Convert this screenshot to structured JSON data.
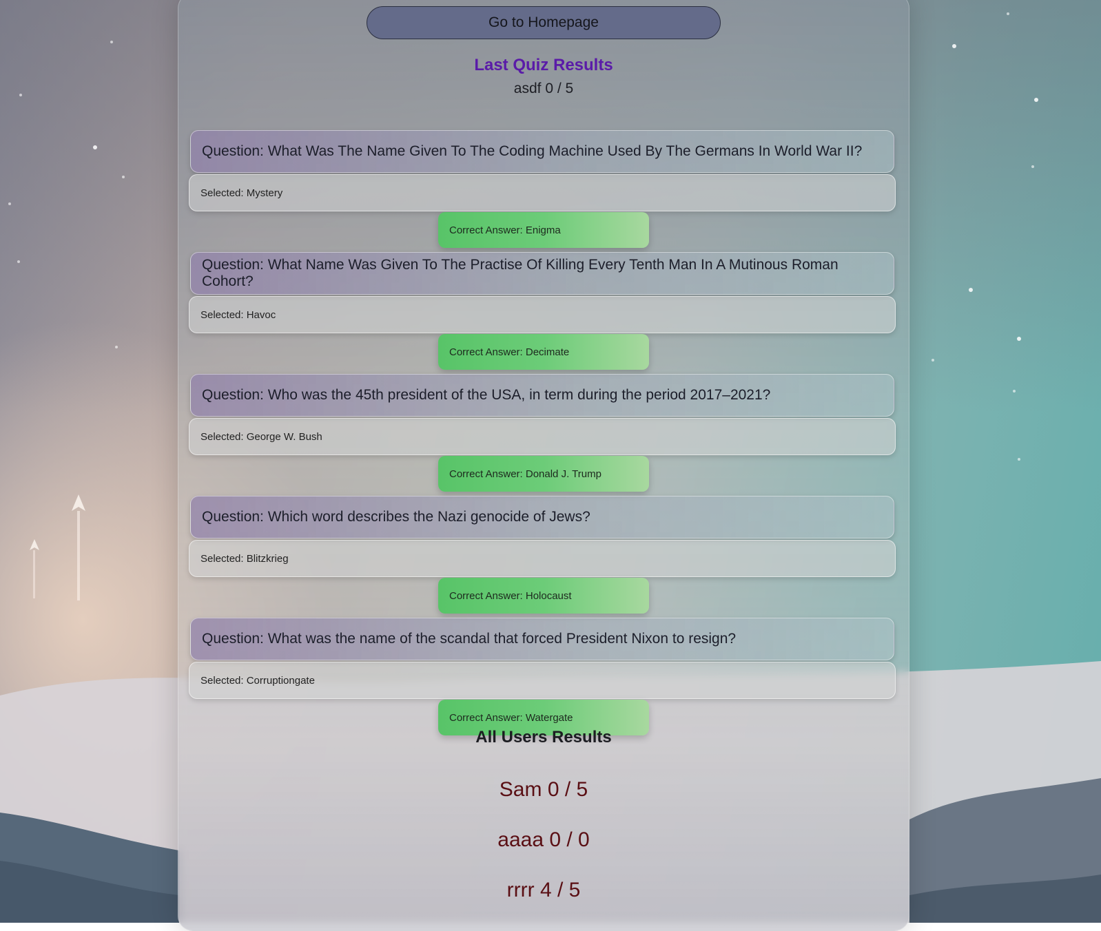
{
  "nav": {
    "home_label": "Go to Homepage"
  },
  "last_quiz": {
    "title": "Last Quiz Results",
    "score": "asdf 0 / 5",
    "items": [
      {
        "question": "Question: What Was The Name Given To The Coding Machine Used By The Germans In World War II?",
        "selected": "Selected: Mystery",
        "correct": "Correct Answer: Enigma"
      },
      {
        "question": "Question: What Name Was Given To The Practise Of Killing Every Tenth Man In A Mutinous Roman Cohort?",
        "selected": "Selected: Havoc",
        "correct": "Correct Answer: Decimate"
      },
      {
        "question": "Question: Who was the 45th president of the USA, in term during the period 2017–2021?",
        "selected": "Selected: George W. Bush",
        "correct": "Correct Answer: Donald J. Trump"
      },
      {
        "question": "Question: Which word describes the Nazi genocide of Jews?",
        "selected": "Selected: Blitzkrieg",
        "correct": "Correct Answer: Holocaust"
      },
      {
        "question": "Question: What was the name of the scandal that forced President Nixon to resign?",
        "selected": "Selected: Corruptiongate",
        "correct": "Correct Answer: Watergate"
      }
    ]
  },
  "all_users": {
    "title": "All Users Results",
    "scores": [
      "Sam 0 / 5",
      "aaaa 0 / 0",
      "rrrr 4 / 5"
    ]
  },
  "colors": {
    "title_purple": "#5a1ba8",
    "score_red": "#5a0f14",
    "correct_green": "#58c468",
    "home_button": "#646b8a"
  }
}
